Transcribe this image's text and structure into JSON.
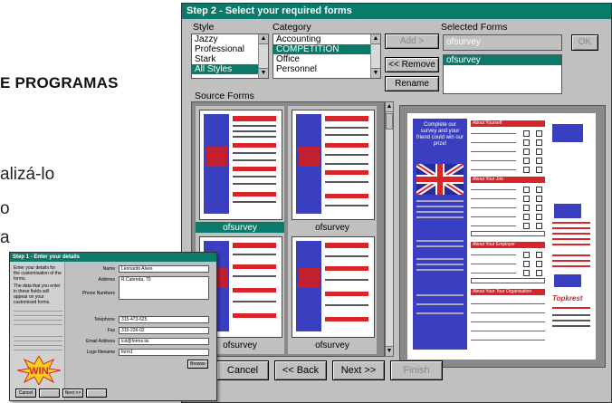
{
  "magazine": {
    "heading": "E PROGRAMAS",
    "text_line1": "alizá-lo",
    "text_line2": "o",
    "text_line3": "a"
  },
  "main_window": {
    "title": "Step 2 - Select your required forms",
    "style_label": "Style",
    "category_label": "Category",
    "selected_forms_label": "Selected Forms",
    "source_forms_label": "Source Forms",
    "style_items": [
      "Jazzy",
      "Professional",
      "Stark",
      "All Styles"
    ],
    "style_selected_index": 3,
    "category_items": [
      "Accounting",
      "COMPETITION",
      "Office",
      "Personnel"
    ],
    "category_selected_index": 1,
    "selected_form_value": "ofsurvey",
    "selected_forms_list": [
      "ofsurvey"
    ],
    "buttons": {
      "add": "Add >",
      "remove": "<< Remove",
      "rename": "Rename",
      "ok": "OK",
      "cancel": "Cancel",
      "back": "<< Back",
      "next": "Next >>",
      "finish": "Finish"
    },
    "thumbnails": [
      {
        "caption": "ofsurvey",
        "selected": true
      },
      {
        "caption": "ofsurvey",
        "selected": false
      },
      {
        "caption": "ofsurvey",
        "selected": false
      },
      {
        "caption": "ofsurvey",
        "selected": false
      }
    ],
    "preview": {
      "intro_text": "Complete our survey and your friend could win our prize!",
      "sections": [
        "About Yourself",
        "About Your Job",
        "About Your Employer",
        "About Your Tour Organisation"
      ],
      "brand": "Topkrest"
    }
  },
  "second_window": {
    "title": "Step 1 - Enter your details",
    "intro": "Enter your details for the customisation of the forms.",
    "note": "The data that you enter in these fields will appear on your customised forms.",
    "labels": [
      "Name",
      "Address",
      "Phone Numbers",
      "Telephone",
      "Fax",
      "Email Address",
      "Logo filename"
    ],
    "values": {
      "name": "Leonardo Alves",
      "address": "R.Cabreda, 70",
      "telephone": "315-473-625",
      "fax": "315-236-02",
      "email": "lcd@forms.tis",
      "logo": "form1"
    },
    "browse": "Browse",
    "buttons": [
      "Cancel",
      "",
      "Next >>",
      ""
    ],
    "badge": "WIN"
  }
}
